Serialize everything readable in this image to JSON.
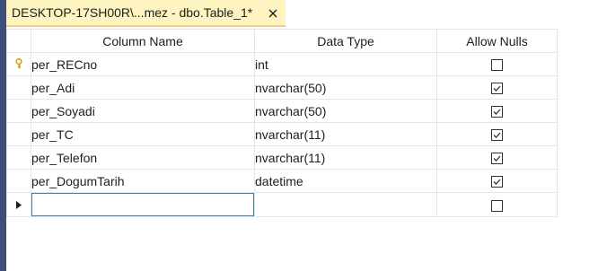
{
  "tab": {
    "title": "DESKTOP-17SH00R\\...mez - dbo.Table_1*"
  },
  "grid": {
    "headers": {
      "column_name": "Column Name",
      "data_type": "Data Type",
      "allow_nulls": "Allow Nulls"
    },
    "rows": [
      {
        "name": "per_RECno",
        "type": "int",
        "allow_nulls": false,
        "primary_key": true
      },
      {
        "name": "per_Adi",
        "type": "nvarchar(50)",
        "allow_nulls": true,
        "primary_key": false
      },
      {
        "name": "per_Soyadi",
        "type": "nvarchar(50)",
        "allow_nulls": true,
        "primary_key": false
      },
      {
        "name": "per_TC",
        "type": "nvarchar(11)",
        "allow_nulls": true,
        "primary_key": false
      },
      {
        "name": "per_Telefon",
        "type": "nvarchar(11)",
        "allow_nulls": true,
        "primary_key": false
      },
      {
        "name": "per_DogumTarih",
        "type": "datetime",
        "allow_nulls": true,
        "primary_key": false
      }
    ],
    "new_row": {
      "name": "",
      "type": "",
      "allow_nulls": false
    }
  },
  "colors": {
    "tab_background": "#fdf4bf",
    "left_strip": "#3c4f7a",
    "key_icon": "#d4a017",
    "input_border": "#3c7fb1"
  }
}
